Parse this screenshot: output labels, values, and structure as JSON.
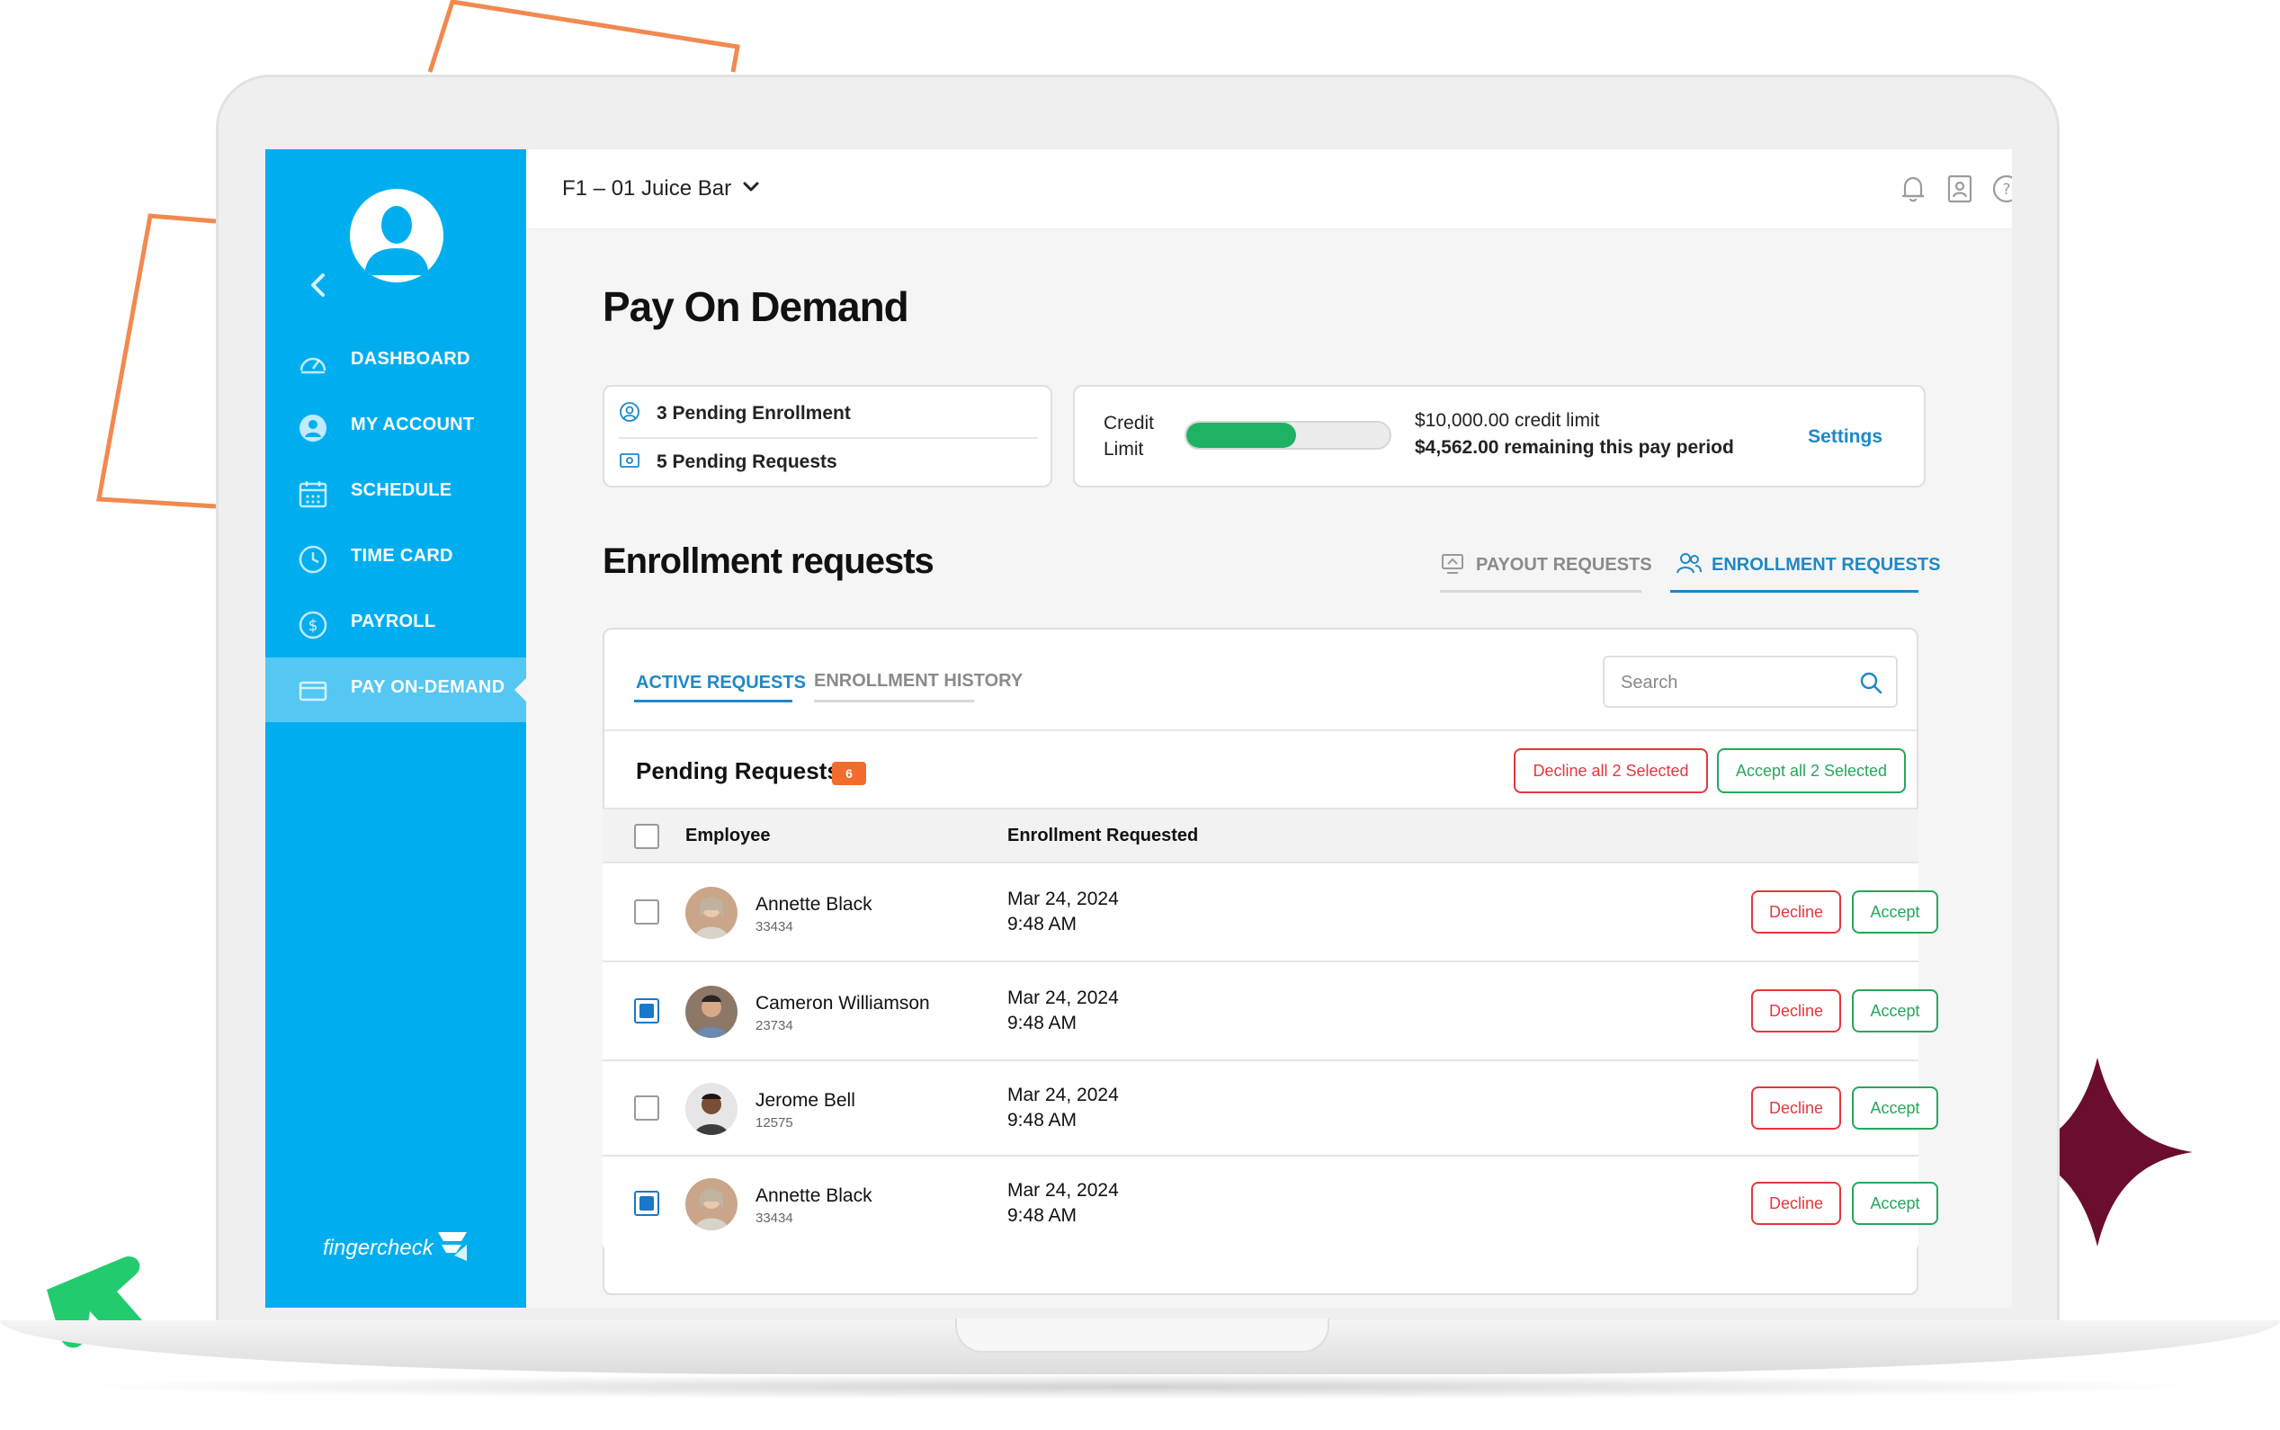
{
  "app": {
    "location": "F1 – 01 Juice Bar",
    "brand": "fingercheck"
  },
  "sidebar": {
    "items": [
      {
        "label": "DASHBOARD",
        "icon": "speedometer-icon"
      },
      {
        "label": "MY ACCOUNT",
        "icon": "user-circle-icon"
      },
      {
        "label": "SCHEDULE",
        "icon": "calendar-icon"
      },
      {
        "label": "TIME CARD",
        "icon": "clock-icon"
      },
      {
        "label": "PAYROLL",
        "icon": "dollar-circle-icon"
      },
      {
        "label": "PAY ON-DEMAND",
        "icon": "credit-card-icon",
        "active": true
      }
    ]
  },
  "header": {
    "icons": [
      "bell-icon",
      "contact-card-icon",
      "help-icon"
    ]
  },
  "page": {
    "title": "Pay On Demand"
  },
  "summary": {
    "pending_enrollment": "3 Pending Enrollment",
    "pending_requests": "5 Pending Requests"
  },
  "credit": {
    "label": "Credit Limit",
    "limit_amount": "$10,000.00",
    "limit_suffix": "credit limit",
    "remaining": "$4,562.00 remaining this pay period",
    "usage_fraction": 0.54,
    "settings_label": "Settings",
    "bar_color": "#1fb264"
  },
  "section": {
    "title": "Enrollment requests",
    "view_tabs": [
      {
        "label": "PAYOUT REQUESTS",
        "active": false
      },
      {
        "label": "ENROLLMENT REQUESTS",
        "active": true
      }
    ]
  },
  "panel": {
    "tabs": [
      {
        "label": "ACTIVE REQUESTS",
        "active": true
      },
      {
        "label": "ENROLLMENT HISTORY",
        "active": false
      }
    ],
    "search_placeholder": "Search",
    "pending_title": "Pending Requests",
    "pending_count": "6",
    "decline_all_label": "Decline all 2 Selected",
    "accept_all_label": "Accept all 2 Selected"
  },
  "table": {
    "columns": [
      "Employee",
      "Enrollment Requested"
    ],
    "rows": [
      {
        "name": "Annette Black",
        "id": "33434",
        "date": "Mar 24, 2024",
        "time": "9:48 AM",
        "checked": false
      },
      {
        "name": "Cameron Williamson",
        "id": "23734",
        "date": "Mar 24, 2024",
        "time": "9:48 AM",
        "checked": true
      },
      {
        "name": "Jerome Bell",
        "id": "12575",
        "date": "Mar 24, 2024",
        "time": "9:48 AM",
        "checked": false
      },
      {
        "name": "Annette Black",
        "id": "33434",
        "date": "Mar 24, 2024",
        "time": "9:48 AM",
        "checked": true
      }
    ],
    "decline_label": "Decline",
    "accept_label": "Accept"
  },
  "colors": {
    "sidebar": "#00aeef",
    "accent_blue": "#1e88c7",
    "decline": "#e4373d",
    "accept": "#24a85b",
    "badge": "#f26c2d"
  }
}
